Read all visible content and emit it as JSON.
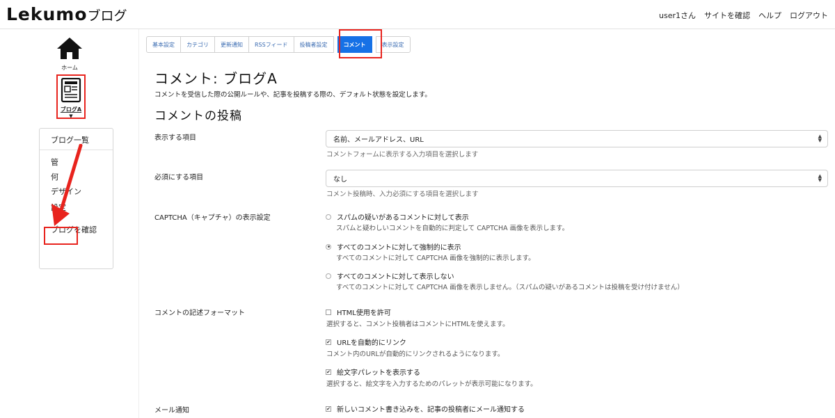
{
  "header": {
    "brand_name": "Lekumo",
    "brand_suffix": "ブログ",
    "nav": [
      "user1さん",
      "サイトを確認",
      "ヘルプ",
      "ログアウト"
    ]
  },
  "sidebar": {
    "home_label": "ホーム",
    "blog_label": "ブログA",
    "menu": {
      "blog_list": "ブログ一覧",
      "manage_partial": "管",
      "post_partial": "何",
      "design": "デザイン",
      "settings": "設定",
      "view_blog": "ブログを確認"
    }
  },
  "tabs": [
    "基本設定",
    "カテゴリ",
    "更新通知",
    "RSSフィード",
    "投稿者設定",
    "コメント",
    "表示設定"
  ],
  "active_tab": "コメント",
  "page": {
    "title": "コメント: ブログA",
    "description": "コメントを受信した際の公開ルールや、記事を投稿する際の、デフォルト状態を設定します。",
    "section_title": "コメントの投稿"
  },
  "fields": {
    "display_items": {
      "label": "表示する項目",
      "value": "名前、メールアドレス、URL",
      "help": "コメントフォームに表示する入力項目を選択します"
    },
    "required_items": {
      "label": "必須にする項目",
      "value": "なし",
      "help": "コメント投稿時、入力必須にする項目を選択します"
    },
    "captcha": {
      "label": "CAPTCHA（キャプチャ）の表示設定",
      "options": [
        {
          "label": "スパムの疑いがあるコメントに対して表示",
          "help": "スパムと疑わしいコメントを自動的に判定して CAPTCHA 画像を表示します。",
          "selected": false
        },
        {
          "label": "すべてのコメントに対して強制的に表示",
          "help": "すべてのコメントに対して CAPTCHA 画像を強制的に表示します。",
          "selected": true
        },
        {
          "label": "すべてのコメントに対して表示しない",
          "help": "すべてのコメントに対して CAPTCHA 画像を表示しません。（スパムの疑いがあるコメントは投稿を受け付けません）",
          "selected": false
        }
      ]
    },
    "format": {
      "label": "コメントの記述フォーマット",
      "options": [
        {
          "label": "HTML使用を許可",
          "help": "選択すると、コメント投稿者はコメントにHTMLを使えます。",
          "checked": false
        },
        {
          "label": "URLを自動的にリンク",
          "help": "コメント内のURLが自動的にリンクされるようになります。",
          "checked": true
        },
        {
          "label": "絵文字パレットを表示する",
          "help": "選択すると、絵文字を入力するためのパレットが表示可能になります。",
          "checked": true
        }
      ]
    },
    "mail": {
      "label": "メール通知",
      "option": "新しいコメント書き込みを、記事の投稿者にメール通知する",
      "checked": true
    }
  },
  "colors": {
    "active_tab": "#1671e6",
    "annotation": "#e8231d",
    "tab_text": "#3a6bb1"
  }
}
